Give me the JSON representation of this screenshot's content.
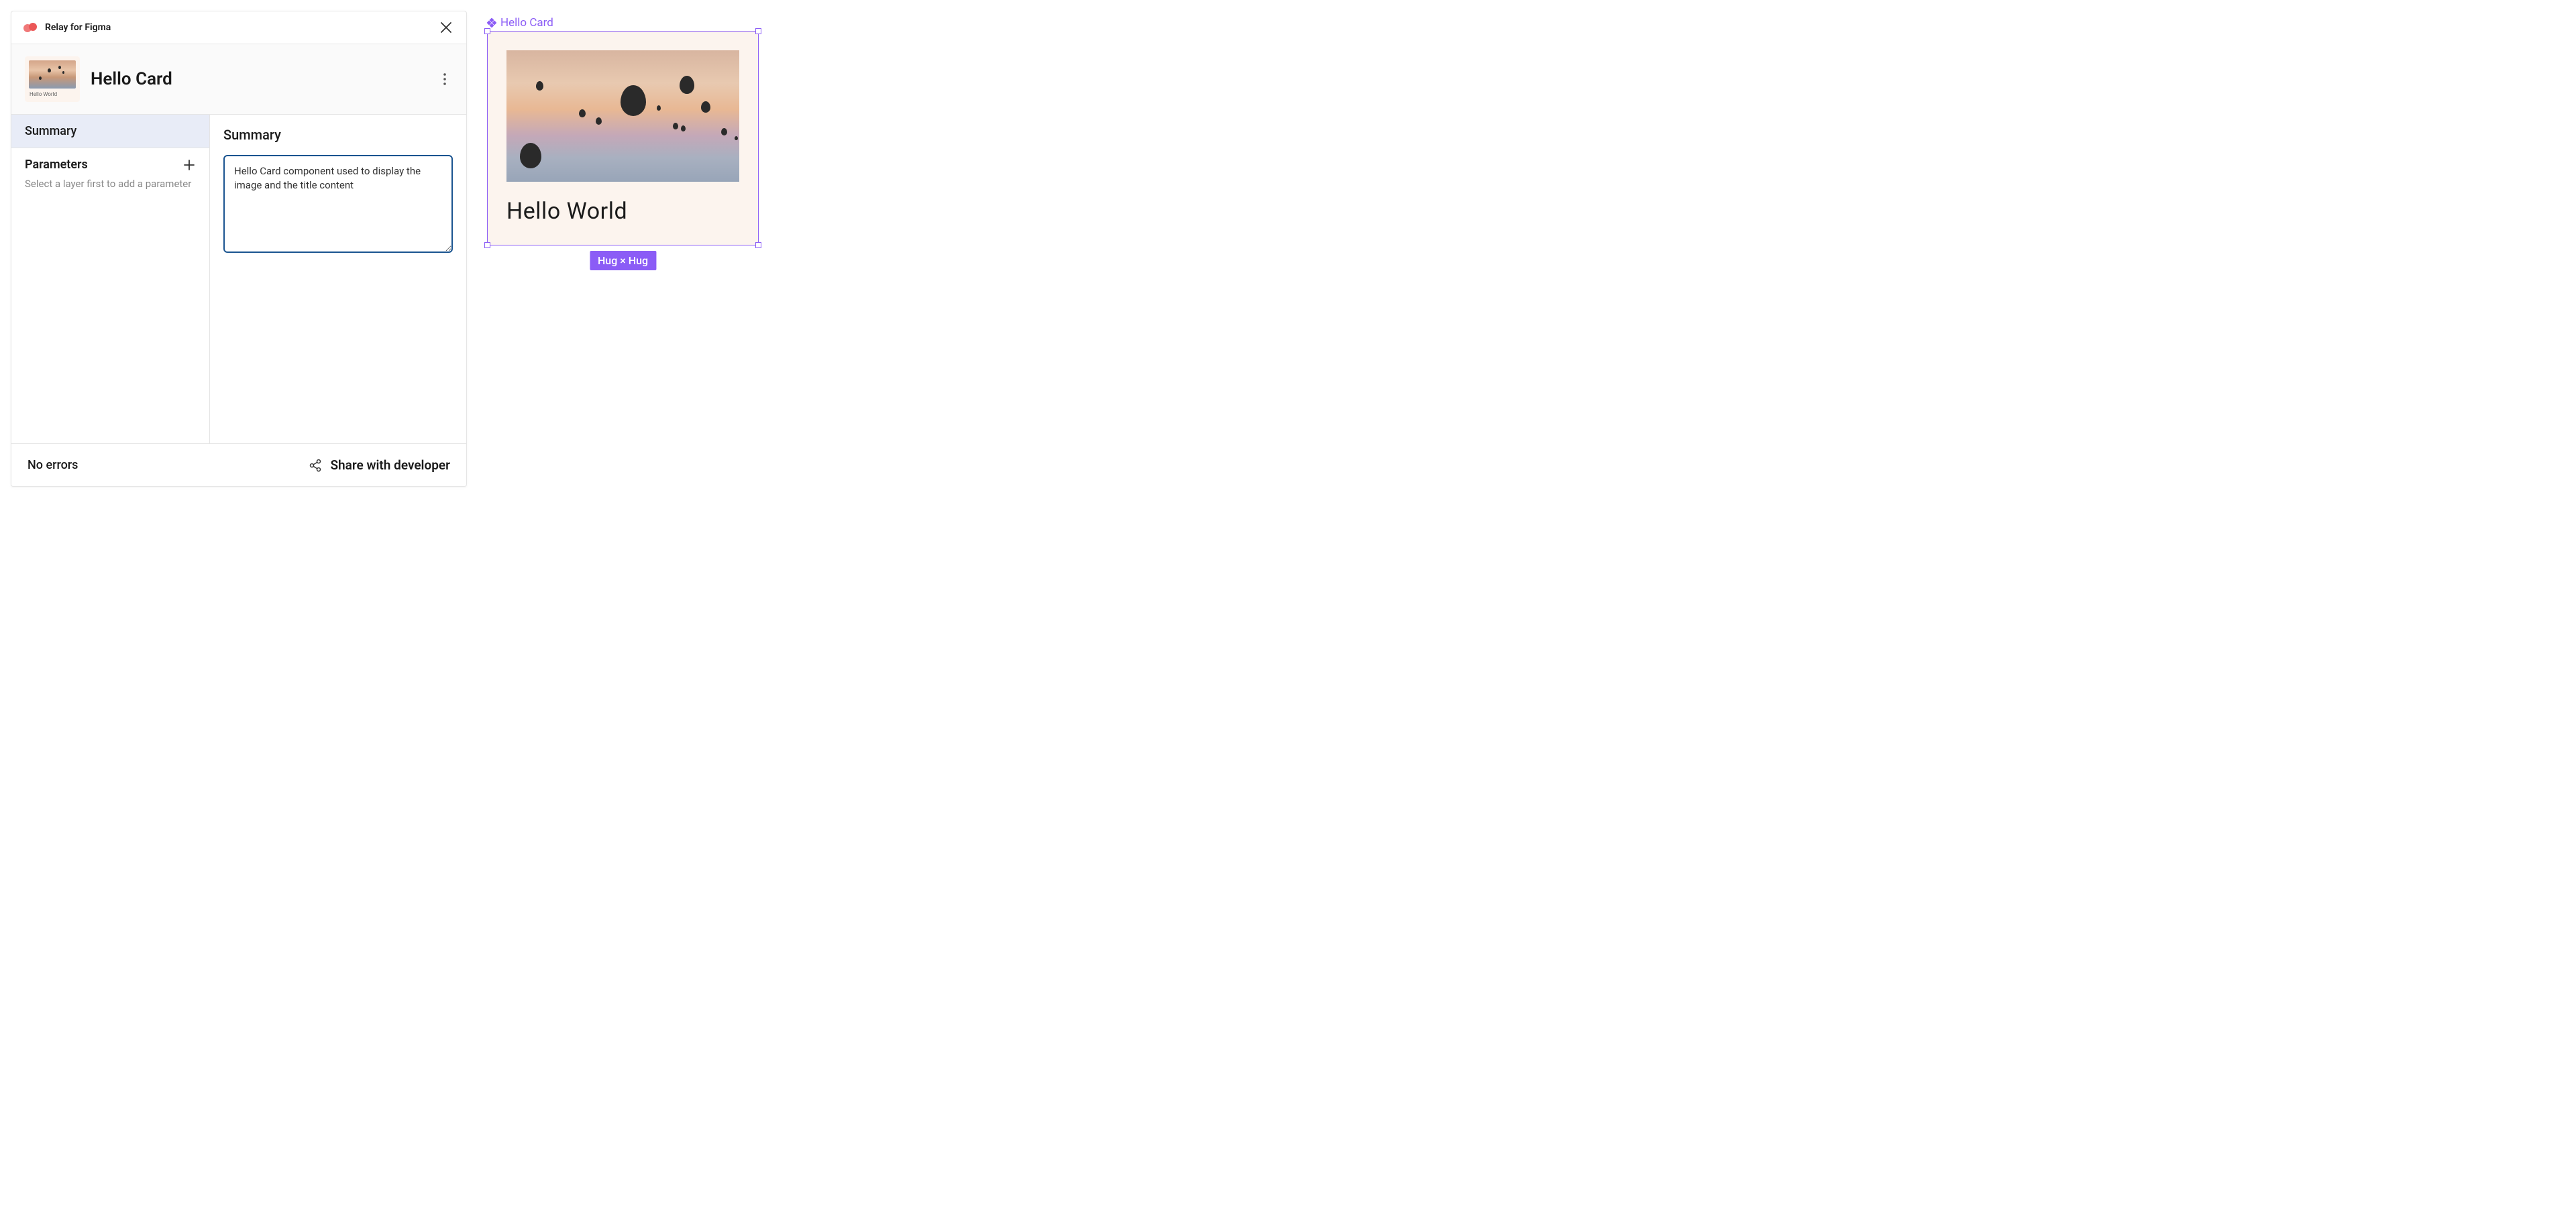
{
  "header": {
    "title": "Relay for Figma"
  },
  "component": {
    "name": "Hello Card",
    "thumbnail_caption": "Hello World"
  },
  "sidebar": {
    "summary_tab": "Summary",
    "parameters_title": "Parameters",
    "parameters_hint": "Select a layer first to add a parameter"
  },
  "content": {
    "heading": "Summary",
    "textarea_value": "Hello Card component used to display the image and the title content"
  },
  "footer": {
    "errors": "No errors",
    "share": "Share with developer"
  },
  "canvas": {
    "label": "Hello Card",
    "card_title": "Hello World",
    "size_badge": "Hug × Hug"
  }
}
